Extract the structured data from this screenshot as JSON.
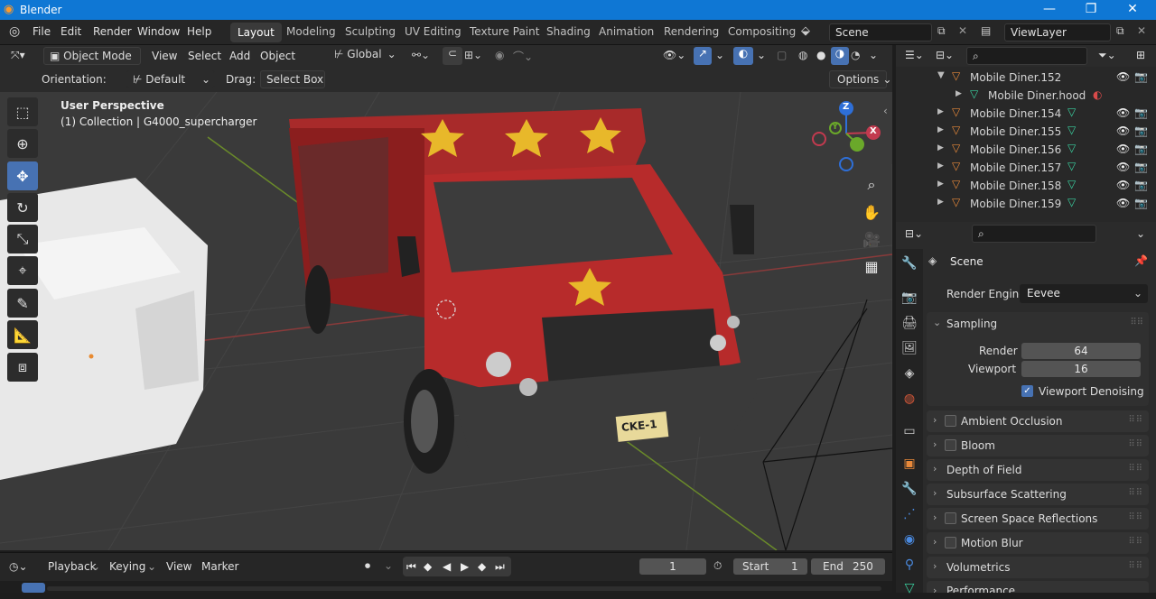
{
  "app": {
    "title": "Blender"
  },
  "colors": {
    "accent": "#4772b3",
    "titlebar": "#0f77d4"
  },
  "menu": {
    "file": "File",
    "edit": "Edit",
    "render": "Render",
    "window": "Window",
    "help": "Help"
  },
  "workspaces": [
    "Layout",
    "Modeling",
    "Sculpting",
    "UV Editing",
    "Texture Paint",
    "Shading",
    "Animation",
    "Rendering",
    "Compositing"
  ],
  "scene_field": "Scene",
  "viewlayer_field": "ViewLayer",
  "viewport": {
    "mode": "Object Mode",
    "menus": [
      "View",
      "Select",
      "Add",
      "Object"
    ],
    "transform_orientation": "Global",
    "orientation_label": "Orientation:",
    "orientation_value": "Default",
    "drag_label": "Drag:",
    "drag_value": "Select Box",
    "options": "Options",
    "perspective": "User Perspective",
    "collection_info": "(1) Collection | G4000_supercharger",
    "gizmo": {
      "z": "Z",
      "y": "Y",
      "x": "X"
    },
    "plate": "CKE-1"
  },
  "outliner": {
    "items": [
      {
        "label": "Mobile Diner.152",
        "indent": 0
      },
      {
        "label": "Mobile Diner.hood",
        "indent": 1
      },
      {
        "label": "Mobile Diner.154",
        "indent": 0
      },
      {
        "label": "Mobile Diner.155",
        "indent": 0
      },
      {
        "label": "Mobile Diner.156",
        "indent": 0
      },
      {
        "label": "Mobile Diner.157",
        "indent": 0
      },
      {
        "label": "Mobile Diner.158",
        "indent": 0
      },
      {
        "label": "Mobile Diner.159",
        "indent": 0
      }
    ]
  },
  "properties": {
    "context": "Scene",
    "render_engine_label": "Render Engine",
    "render_engine_value": "Eevee",
    "sampling": {
      "title": "Sampling",
      "render_label": "Render",
      "render_value": "64",
      "viewport_label": "Viewport",
      "viewport_value": "16",
      "denoise_label": "Viewport Denoising"
    },
    "panels": [
      "Ambient Occlusion",
      "Bloom",
      "Depth of Field",
      "Subsurface Scattering",
      "Screen Space Reflections",
      "Motion Blur",
      "Volumetrics",
      "Performance"
    ]
  },
  "timeline": {
    "menus": [
      "Playback",
      "Keying",
      "View",
      "Marker"
    ],
    "current_frame": "1",
    "start_label": "Start",
    "start_value": "1",
    "end_label": "End",
    "end_value": "250"
  }
}
